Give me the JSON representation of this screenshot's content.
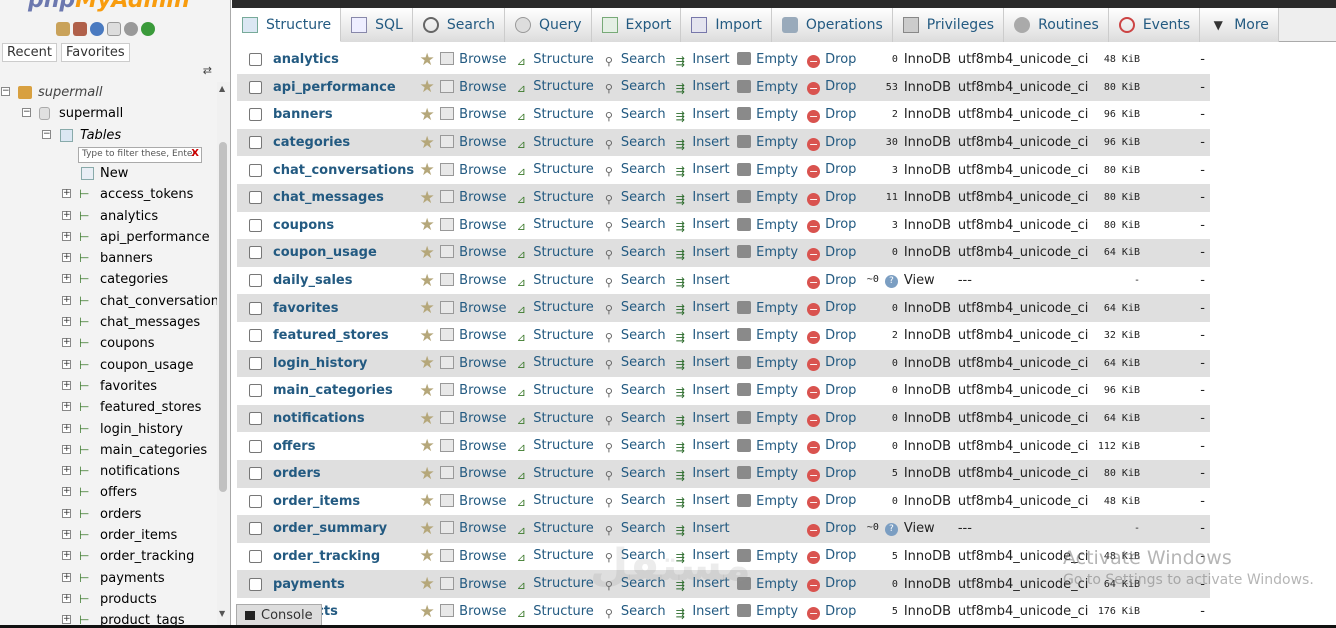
{
  "app": {
    "logo_left": "php",
    "logo_right": "MyAdmin"
  },
  "nav": {
    "recent": "Recent",
    "favorites": "Favorites",
    "chain": "⇄"
  },
  "tree": {
    "server": "supermall",
    "db": "supermall",
    "tables_label": "Tables",
    "filter_placeholder": "Type to filter these, Enter",
    "filter_clear": "X",
    "new": "New",
    "items": [
      "access_tokens",
      "analytics",
      "api_performance",
      "banners",
      "categories",
      "chat_conversations",
      "chat_messages",
      "coupons",
      "coupon_usage",
      "favorites",
      "featured_stores",
      "login_history",
      "main_categories",
      "notifications",
      "offers",
      "orders",
      "order_items",
      "order_tracking",
      "payments",
      "products",
      "product_tags"
    ]
  },
  "tabs": [
    {
      "label": "Structure",
      "icon": "structure-icon"
    },
    {
      "label": "SQL",
      "icon": "sql-icon"
    },
    {
      "label": "Search",
      "icon": "search-icon"
    },
    {
      "label": "Query",
      "icon": "query-icon"
    },
    {
      "label": "Export",
      "icon": "export-icon"
    },
    {
      "label": "Import",
      "icon": "import-icon"
    },
    {
      "label": "Operations",
      "icon": "wrench-icon"
    },
    {
      "label": "Privileges",
      "icon": "privileges-icon"
    },
    {
      "label": "Routines",
      "icon": "routines-icon"
    },
    {
      "label": "Events",
      "icon": "events-icon"
    },
    {
      "label": "More",
      "icon": "chevron-down-icon"
    }
  ],
  "actions": {
    "browse": "Browse",
    "structure": "Structure",
    "search": "Search",
    "insert": "Insert",
    "empty": "Empty",
    "drop": "Drop"
  },
  "rows": [
    {
      "name": "analytics",
      "rows": "0",
      "engine": "InnoDB",
      "collation": "utf8mb4_unicode_ci",
      "size": "48 KiB",
      "overhead": "-"
    },
    {
      "name": "api_performance",
      "rows": "53",
      "engine": "InnoDB",
      "collation": "utf8mb4_unicode_ci",
      "size": "80 KiB",
      "overhead": "-"
    },
    {
      "name": "banners",
      "rows": "2",
      "engine": "InnoDB",
      "collation": "utf8mb4_unicode_ci",
      "size": "96 KiB",
      "overhead": "-"
    },
    {
      "name": "categories",
      "rows": "30",
      "engine": "InnoDB",
      "collation": "utf8mb4_unicode_ci",
      "size": "96 KiB",
      "overhead": "-"
    },
    {
      "name": "chat_conversations",
      "rows": "3",
      "engine": "InnoDB",
      "collation": "utf8mb4_unicode_ci",
      "size": "80 KiB",
      "overhead": "-"
    },
    {
      "name": "chat_messages",
      "rows": "11",
      "engine": "InnoDB",
      "collation": "utf8mb4_unicode_ci",
      "size": "80 KiB",
      "overhead": "-"
    },
    {
      "name": "coupons",
      "rows": "3",
      "engine": "InnoDB",
      "collation": "utf8mb4_unicode_ci",
      "size": "80 KiB",
      "overhead": "-"
    },
    {
      "name": "coupon_usage",
      "rows": "0",
      "engine": "InnoDB",
      "collation": "utf8mb4_unicode_ci",
      "size": "64 KiB",
      "overhead": "-"
    },
    {
      "name": "daily_sales",
      "rows": "~0",
      "engine": "View",
      "collation": "---",
      "size": "-",
      "overhead": "-",
      "view": true
    },
    {
      "name": "favorites",
      "rows": "0",
      "engine": "InnoDB",
      "collation": "utf8mb4_unicode_ci",
      "size": "64 KiB",
      "overhead": "-"
    },
    {
      "name": "featured_stores",
      "rows": "2",
      "engine": "InnoDB",
      "collation": "utf8mb4_unicode_ci",
      "size": "32 KiB",
      "overhead": "-"
    },
    {
      "name": "login_history",
      "rows": "0",
      "engine": "InnoDB",
      "collation": "utf8mb4_unicode_ci",
      "size": "64 KiB",
      "overhead": "-"
    },
    {
      "name": "main_categories",
      "rows": "0",
      "engine": "InnoDB",
      "collation": "utf8mb4_unicode_ci",
      "size": "96 KiB",
      "overhead": "-"
    },
    {
      "name": "notifications",
      "rows": "0",
      "engine": "InnoDB",
      "collation": "utf8mb4_unicode_ci",
      "size": "64 KiB",
      "overhead": "-"
    },
    {
      "name": "offers",
      "rows": "0",
      "engine": "InnoDB",
      "collation": "utf8mb4_unicode_ci",
      "size": "112 KiB",
      "overhead": "-"
    },
    {
      "name": "orders",
      "rows": "5",
      "engine": "InnoDB",
      "collation": "utf8mb4_unicode_ci",
      "size": "80 KiB",
      "overhead": "-"
    },
    {
      "name": "order_items",
      "rows": "0",
      "engine": "InnoDB",
      "collation": "utf8mb4_unicode_ci",
      "size": "48 KiB",
      "overhead": "-"
    },
    {
      "name": "order_summary",
      "rows": "~0",
      "engine": "View",
      "collation": "---",
      "size": "-",
      "overhead": "-",
      "view": true
    },
    {
      "name": "order_tracking",
      "rows": "5",
      "engine": "InnoDB",
      "collation": "utf8mb4_unicode_ci",
      "size": "48 KiB",
      "overhead": "-"
    },
    {
      "name": "payments",
      "rows": "0",
      "engine": "InnoDB",
      "collation": "utf8mb4_unicode_ci",
      "size": "64 KiB",
      "overhead": "-"
    },
    {
      "name": "products",
      "rows": "5",
      "engine": "InnoDB",
      "collation": "utf8mb4_unicode_ci",
      "size": "176 KiB",
      "overhead": "-"
    }
  ],
  "console": "Console",
  "watermark": {
    "line1": "Activate Windows",
    "line2": "Go to Settings to activate Windows.",
    "site": "مستقل"
  },
  "colors": {
    "link": "#235a81",
    "row_even": "#dfdfdf",
    "drop": "#d9534f"
  }
}
